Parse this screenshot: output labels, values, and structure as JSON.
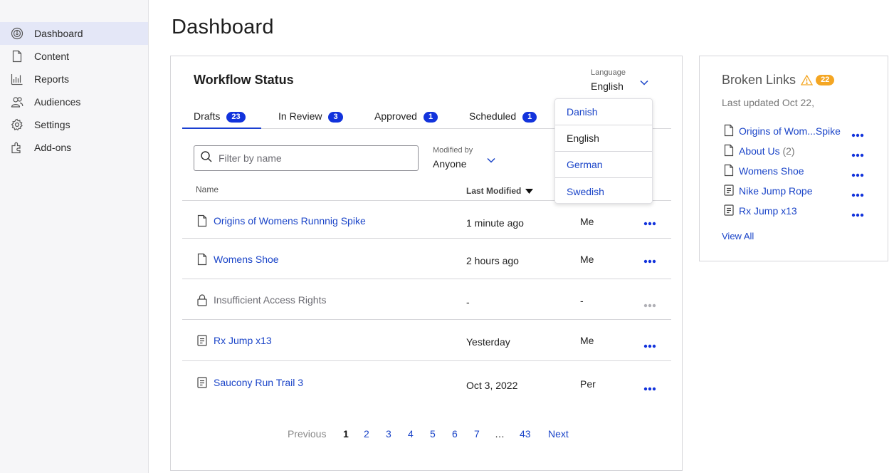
{
  "sidebar": {
    "items": [
      {
        "label": "Dashboard",
        "icon": "dashboard-icon",
        "active": true
      },
      {
        "label": "Content",
        "icon": "document-icon"
      },
      {
        "label": "Reports",
        "icon": "bar-chart-icon"
      },
      {
        "label": "Audiences",
        "icon": "users-icon"
      },
      {
        "label": "Settings",
        "icon": "gear-icon"
      },
      {
        "label": "Add-ons",
        "icon": "puzzle-icon"
      }
    ]
  },
  "page": {
    "title": "Dashboard"
  },
  "workflow": {
    "title": "Workflow Status",
    "language": {
      "label": "Language",
      "value": "English",
      "options": [
        "Danish",
        "English",
        "German",
        "Swedish"
      ]
    },
    "tabs": [
      {
        "label": "Drafts",
        "count": "23",
        "active": true
      },
      {
        "label": "In Review",
        "count": "3"
      },
      {
        "label": "Approved",
        "count": "1"
      },
      {
        "label": "Scheduled",
        "count": "1"
      }
    ],
    "filter": {
      "placeholder": "Filter by name"
    },
    "modified_by": {
      "label": "Modified by",
      "value": "Anyone"
    },
    "columns": {
      "name": "Name",
      "last_modified": "Last Modified"
    },
    "rows": [
      {
        "name": "Origins of Womens Runnnig Spike",
        "date": "1 minute ago",
        "by": "Me",
        "icon": "document-icon"
      },
      {
        "name": "Womens Shoe",
        "date": "2 hours ago",
        "by": "Me",
        "icon": "document-icon"
      },
      {
        "name": "Insufficient Access Rights",
        "date": "-",
        "by": "-",
        "icon": "lock-icon"
      },
      {
        "name": "Rx Jump x13",
        "date": "Yesterday",
        "by": "Me",
        "icon": "product-icon"
      },
      {
        "name": "Saucony Run Trail 3",
        "date": "Oct 3, 2022",
        "by": "Per",
        "icon": "product-icon"
      }
    ],
    "pagination": {
      "prev": "Previous",
      "pages": [
        "1",
        "2",
        "3",
        "4",
        "5",
        "6",
        "7"
      ],
      "ellipsis": "…",
      "last": "43",
      "next": "Next",
      "current": "1"
    }
  },
  "broken_links": {
    "title": "Broken Links",
    "count": "22",
    "updated": "Last updated Oct 22,",
    "items": [
      {
        "name": "Origins of Wom...Spike",
        "count": "",
        "icon": "document-icon"
      },
      {
        "name": "About Us",
        "count": "(2)",
        "icon": "document-icon"
      },
      {
        "name": "Womens Shoe",
        "count": "",
        "icon": "document-icon"
      },
      {
        "name": "Nike Jump Rope",
        "count": "",
        "icon": "product-icon"
      },
      {
        "name": "Rx Jump x13",
        "count": "",
        "icon": "product-icon"
      }
    ],
    "view_all": "View All"
  },
  "colors": {
    "accent": "#1233dc",
    "link": "#1a44c8",
    "warning": "#f4a623",
    "active_nav": "#e4e7f7"
  }
}
